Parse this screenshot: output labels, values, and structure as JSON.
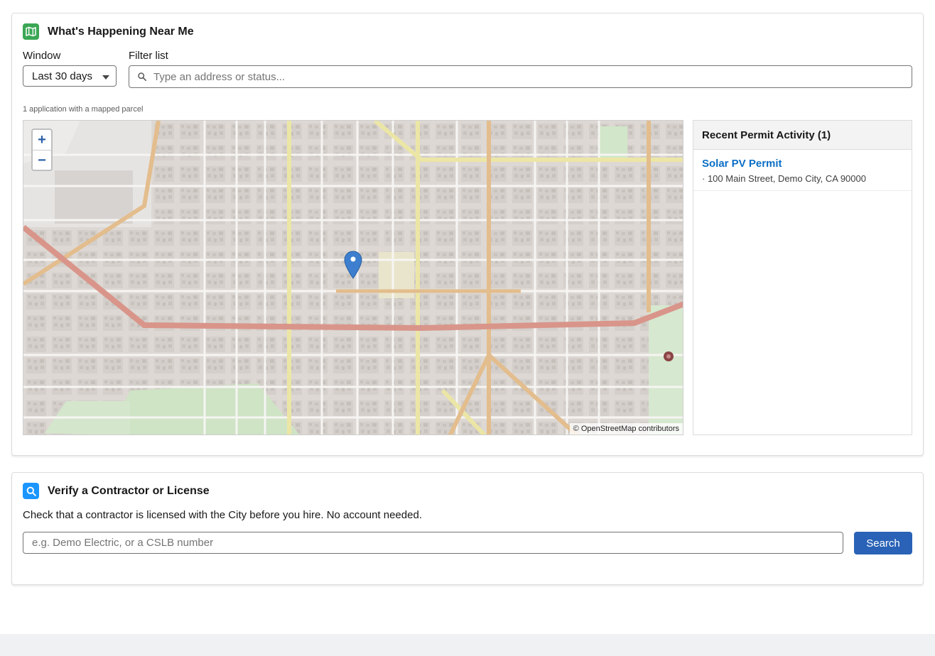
{
  "happening": {
    "title": "What's Happening Near Me",
    "icon": "map-icon",
    "window_label": "Window",
    "window_value": "Last 30 days",
    "filter_label": "Filter list",
    "filter_placeholder": "Type an address or status...",
    "mapped_note": "1 application with a mapped parcel"
  },
  "map": {
    "zoom_in": "+",
    "zoom_out": "−",
    "attribution": "© OpenStreetMap contributors",
    "marker_icon": "map-pin-icon"
  },
  "activity": {
    "title": "Recent Permit Activity (1)",
    "items": [
      {
        "name": "Solar PV Permit",
        "address": "· 100 Main Street, Demo City, CA 90000"
      }
    ]
  },
  "verify": {
    "title": "Verify a Contractor or License",
    "icon": "search-icon",
    "description": "Check that a contractor is licensed with the City before you hire. No account needed.",
    "placeholder": "e.g. Demo Electric, or a CSLB number",
    "button": "Search"
  },
  "colors": {
    "accent": "#2962b6",
    "link": "#0b6fc6",
    "green_icon": "#3ba755",
    "blue_icon": "#1b96ff",
    "marker": "#3d7fce"
  }
}
